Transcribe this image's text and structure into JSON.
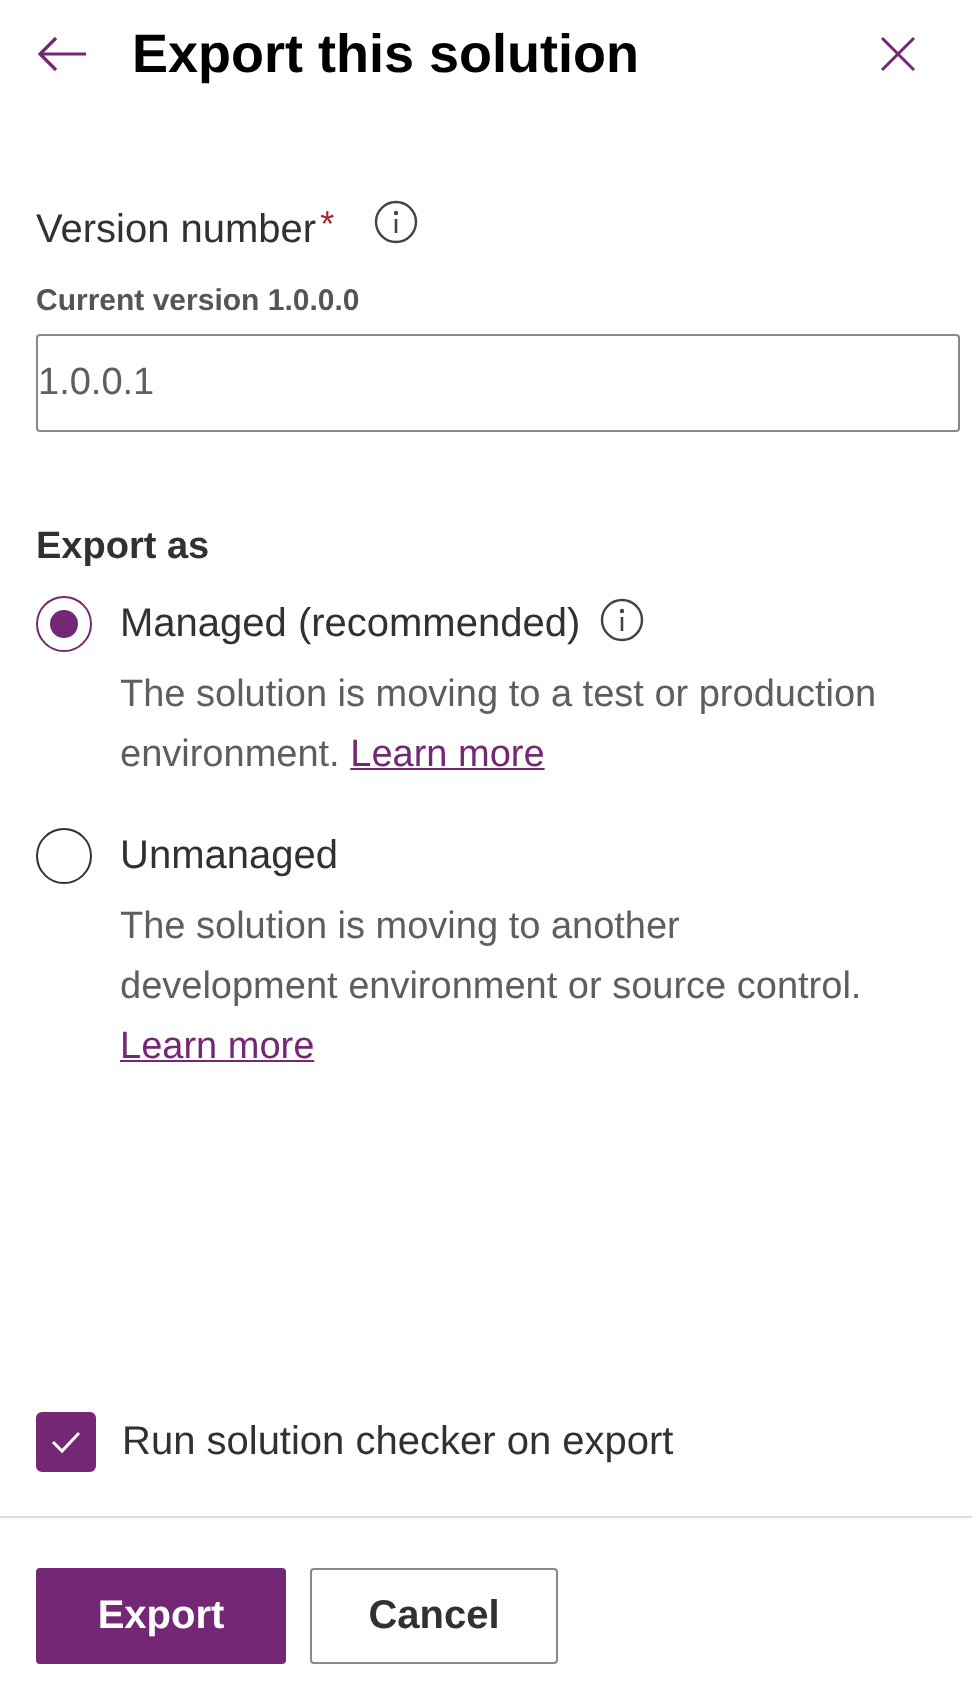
{
  "header": {
    "title": "Export this solution"
  },
  "version": {
    "label": "Version number",
    "required_mark": "*",
    "has_info": true,
    "hint": "Current version 1.0.0.0",
    "value": "1.0.0.1"
  },
  "export_as": {
    "label": "Export as",
    "options": [
      {
        "label": "Managed (recommended)",
        "selected": true,
        "has_info": true,
        "description": "The solution is moving to a test or production environment.",
        "link": "Learn more"
      },
      {
        "label": "Unmanaged",
        "selected": false,
        "has_info": false,
        "description": "The solution is moving to another development environment or source control.",
        "link": "Learn more"
      }
    ]
  },
  "checker": {
    "label": "Run solution checker on export",
    "checked": true
  },
  "buttons": [
    {
      "label": "Export",
      "kind": "primary"
    },
    {
      "label": "Cancel",
      "kind": "secondary"
    }
  ]
}
